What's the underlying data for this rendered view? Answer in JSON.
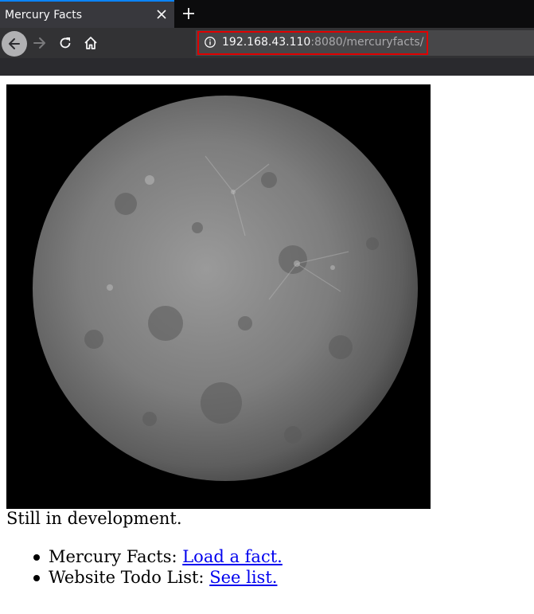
{
  "browser": {
    "tab": {
      "title": "Mercury Facts"
    },
    "url": {
      "host": "192.168.43.110",
      "rest": ":8080/mercuryfacts/"
    }
  },
  "icons": {
    "tab_close": "close-icon",
    "new_tab": "plus-icon",
    "back": "arrow-left-icon",
    "forward": "arrow-right-icon",
    "reload": "reload-icon",
    "home": "home-icon",
    "site_info": "info-icon"
  },
  "colors": {
    "accent": "#0a84ff",
    "highlight": "#e00000",
    "link": "#0000ee"
  },
  "page": {
    "status": "Still in development.",
    "items": [
      {
        "label": "Mercury Facts: ",
        "link": "Load a fact."
      },
      {
        "label": "Website Todo List: ",
        "link": "See list."
      }
    ]
  }
}
